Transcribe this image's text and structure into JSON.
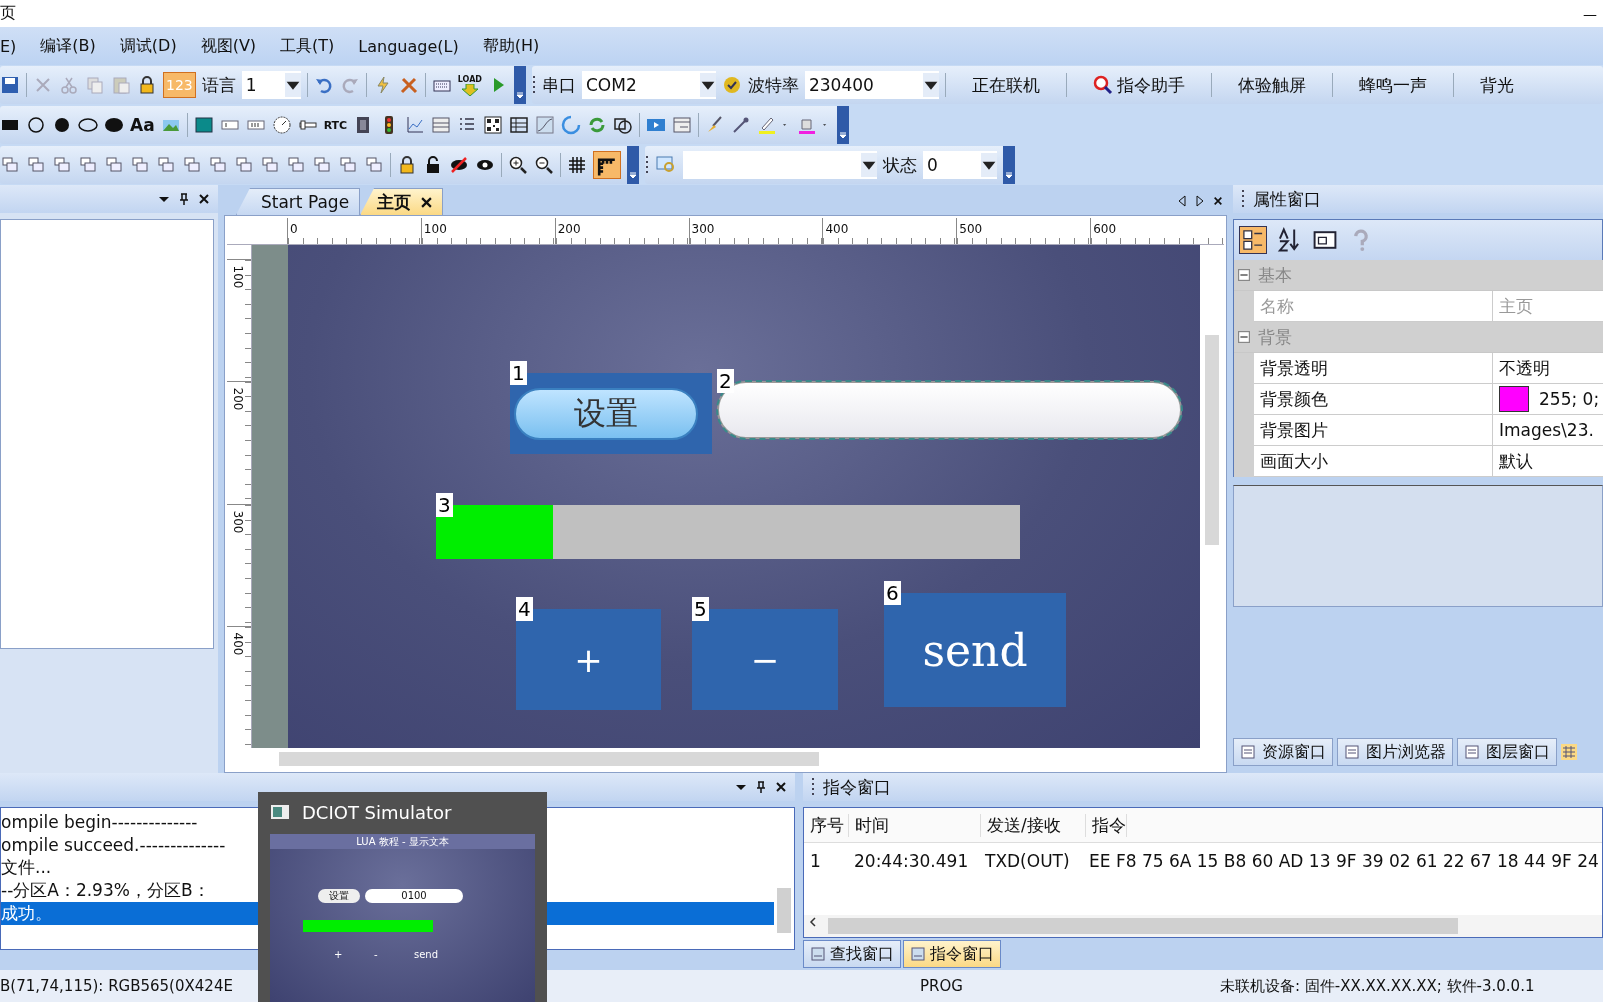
{
  "title_bar": {
    "title": "页",
    "minimize": "—"
  },
  "menu": [
    "E)",
    "编译(B)",
    "调试(D)",
    "视图(V)",
    "工具(T)",
    "Language(L)",
    "帮助(H)"
  ],
  "toolbar_main": {
    "badge": "123",
    "badge_selected": true,
    "language_label": "语言",
    "language_value": "1",
    "load_label": "LOAD",
    "port_label": "串口",
    "port_value": "COM2",
    "baud_label": "波特率",
    "baud_value": "230400",
    "buttons": [
      {
        "label": "正在联机",
        "kind": "plain"
      },
      {
        "label": "指令助手",
        "kind": "icon"
      },
      {
        "label": "体验触屏",
        "kind": "plain"
      },
      {
        "label": "蜂鸣一声",
        "kind": "plain"
      },
      {
        "label": "背光",
        "kind": "plain"
      }
    ]
  },
  "toolbar_widgets": {
    "text_tool": "Aa",
    "rtc_tool": "RTC"
  },
  "toolbar_layout": {
    "ruler_selected": true,
    "state_label": "状态",
    "state_value": "0"
  },
  "editor": {
    "tabs": [
      {
        "label": "Start Page",
        "selected": false
      },
      {
        "label": "主页",
        "selected": true
      }
    ],
    "ruler": {
      "x_ticks": [
        "0",
        "100",
        "200",
        "300",
        "400",
        "500",
        "600"
      ],
      "y_ticks": [
        "100",
        "200",
        "300",
        "400"
      ]
    },
    "widgets": [
      {
        "kind": "pill_button",
        "index": "1",
        "label": "设置",
        "selected": false
      },
      {
        "kind": "textbox",
        "index": "2",
        "selected": true
      },
      {
        "kind": "progress",
        "index": "3",
        "level": 0.2,
        "selected": false
      },
      {
        "kind": "square_button",
        "index": "4",
        "label": "+",
        "selected": false
      },
      {
        "kind": "square_button",
        "index": "5",
        "label": "−",
        "selected": false
      },
      {
        "kind": "square_button",
        "index": "6",
        "label": "send",
        "selected": false
      }
    ]
  },
  "properties": {
    "title": "属性窗口",
    "groups": [
      {
        "name": "基本",
        "expanded": true,
        "rows": [
          {
            "name": "名称",
            "value": "主页",
            "disabled": true
          }
        ]
      },
      {
        "name": "背景",
        "expanded": true,
        "rows": [
          {
            "name": "背景透明",
            "value": "不透明",
            "disabled": false
          },
          {
            "name": "背景颜色",
            "value": "255; 0;",
            "color": "#ff00ff",
            "disabled": false
          },
          {
            "name": "背景图片",
            "value": "Images\\23.",
            "disabled": false
          },
          {
            "name": "画面大小",
            "value": "默认",
            "disabled": false
          }
        ]
      }
    ],
    "tabs": [
      {
        "label": "资源窗口",
        "selected": false
      },
      {
        "label": "图片浏览器",
        "selected": false
      },
      {
        "label": "图层窗口",
        "selected": false
      }
    ]
  },
  "output": {
    "lines": [
      {
        "text": "ompile begin--------------",
        "selected": false
      },
      {
        "text": "ompile succeed.--------------",
        "selected": false
      },
      {
        "text": "文件...",
        "selected": false
      },
      {
        "text": "--分区A：2.93%，分区B：",
        "selected": false
      },
      {
        "text": "成功。",
        "selected": true
      }
    ]
  },
  "simulator": {
    "title": "DCIOT Simulator",
    "header": "LUA 教程 - 显示文本",
    "button": "设置",
    "field": "0100",
    "buttons": [
      "+",
      "-",
      "send"
    ]
  },
  "commands": {
    "title": "指令窗口",
    "columns": [
      "序号",
      "时间",
      "发送/接收",
      "指令"
    ],
    "rows": [
      [
        "1",
        "20:44:30.491",
        "TXD(OUT)",
        "EE F8 75 6A 15 B8 60 AD 13 9F 39 02 61 22 67 18 44 9F 24"
      ]
    ],
    "tabs": [
      {
        "label": "查找窗口",
        "selected": false
      },
      {
        "label": "指令窗口",
        "selected": true
      }
    ]
  },
  "status_bar": {
    "color_info": "B(71,74,115): RGB565(0X424E",
    "mode": "PROG",
    "device": "未联机设备: 固件-XX.XX.XX.XX;  软件-3.0.0.1"
  }
}
